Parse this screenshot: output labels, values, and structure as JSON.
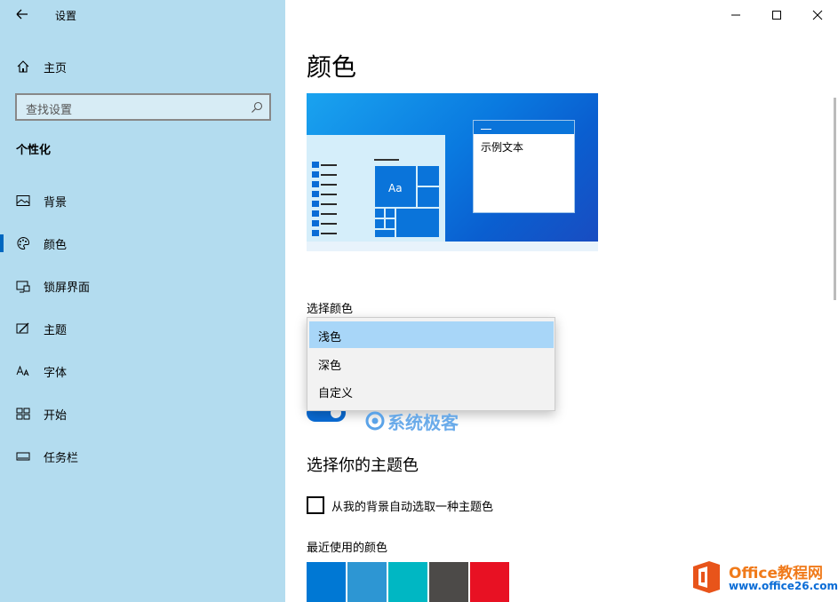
{
  "app": {
    "title": "设置",
    "back_label": "back"
  },
  "sidebar": {
    "home": "主页",
    "search_placeholder": "查找设置",
    "section": "个性化",
    "items": [
      {
        "label": "背景",
        "icon": "picture-icon"
      },
      {
        "label": "颜色",
        "icon": "palette-icon",
        "active": true
      },
      {
        "label": "锁屏界面",
        "icon": "lock-screen-icon"
      },
      {
        "label": "主题",
        "icon": "theme-icon"
      },
      {
        "label": "字体",
        "icon": "font-icon"
      },
      {
        "label": "开始",
        "icon": "start-icon"
      },
      {
        "label": "任务栏",
        "icon": "taskbar-icon"
      }
    ]
  },
  "main": {
    "title": "颜色",
    "preview": {
      "sample_text": "示例文本",
      "tile_text": "Aa"
    },
    "choose_color_label": "选择颜色",
    "dropdown": {
      "options": [
        "浅色",
        "深色",
        "自定义"
      ],
      "selected": "浅色"
    },
    "accent_title": "选择你的主题色",
    "auto_accent_label": "从我的背景自动选取一种主题色",
    "recent_colors_label": "最近使用的颜色",
    "recent_colors": [
      "#0078d4",
      "#2d96d3",
      "#00b7c3",
      "#4c4a48",
      "#e81123"
    ]
  },
  "watermarks": {
    "site1": "系统极客",
    "site2_name": "Office教程网",
    "site2_url": "www.office26.com"
  },
  "colors": {
    "sidebar_bg": "#b3dcef",
    "accent": "#0067c0",
    "dropdown_selected": "#a8d6f8"
  }
}
